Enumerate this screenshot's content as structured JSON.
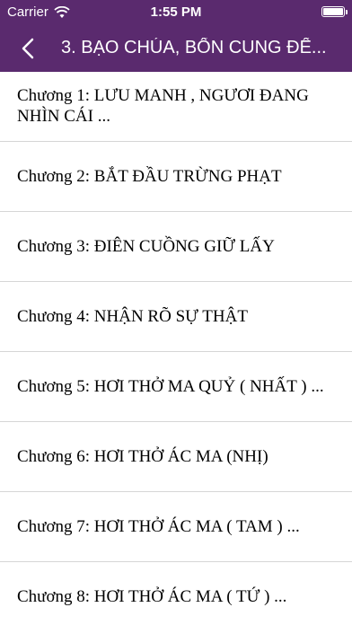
{
  "status_bar": {
    "carrier": "Carrier",
    "time": "1:55 PM",
    "battery_level": 1.0
  },
  "nav_bar": {
    "title": "3. BẠO CHÚA, BỔN CUNG ĐẾ...",
    "back_icon": "chevron-left-icon"
  },
  "chapters": [
    {
      "label": "Chương 1: LƯU MANH , NGƯƠI ĐANG NHÌN CÁI ..."
    },
    {
      "label": "Chương 2: BẮT ĐẦU TRỪNG PHẠT"
    },
    {
      "label": "Chương 3: ĐIÊN CUỒNG GIỮ LẤY"
    },
    {
      "label": "Chương 4: NHẬN RÕ SỰ THẬT"
    },
    {
      "label": "Chương 5: HƠI THỞ MA QUỶ ( NHẤT ) ..."
    },
    {
      "label": "Chương 6: HƠI THỞ ÁC MA (NHỊ)"
    },
    {
      "label": "Chương 7: HƠI THỞ ÁC MA ( TAM ) ..."
    },
    {
      "label": "Chương 8: HƠI THỞ ÁC MA ( TỨ ) ..."
    }
  ],
  "colors": {
    "header_bg": "#5a2a6e",
    "header_text": "#ffffff",
    "separator": "#d6d6d6"
  }
}
